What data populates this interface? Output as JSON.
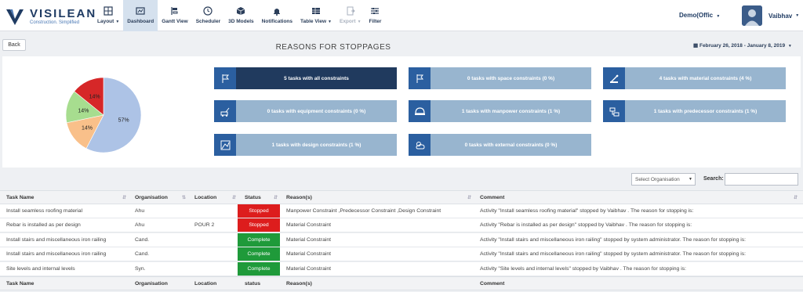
{
  "brand": {
    "name": "VISILEAN",
    "tagline": "Construction. Simplified"
  },
  "nav": [
    {
      "label": "Layout",
      "icon": "layout-icon",
      "caret": true,
      "state": "normal"
    },
    {
      "label": "Dashboard",
      "icon": "dashboard-icon",
      "caret": false,
      "state": "active"
    },
    {
      "label": "Gantt View",
      "icon": "gantt-icon",
      "caret": false,
      "state": "normal"
    },
    {
      "label": "Scheduler",
      "icon": "clock-icon",
      "caret": false,
      "state": "normal"
    },
    {
      "label": "3D Models",
      "icon": "cube-icon",
      "caret": false,
      "state": "normal"
    },
    {
      "label": "Notifications",
      "icon": "bell-icon",
      "caret": false,
      "state": "normal"
    },
    {
      "label": "Table View",
      "icon": "table-icon",
      "caret": true,
      "state": "normal"
    },
    {
      "label": "Export",
      "icon": "export-icon",
      "caret": true,
      "state": "disabled"
    },
    {
      "label": "Filter",
      "icon": "filter-icon",
      "caret": false,
      "state": "normal"
    }
  ],
  "org_menu": {
    "label": "Demo(Offic"
  },
  "user": {
    "name": "Vaibhav"
  },
  "header": {
    "back_label": "Back",
    "title": "REASONS FOR STOPPAGES",
    "date_range": "February 26, 2018 - January 8, 2019"
  },
  "chart_data": {
    "type": "pie",
    "slices": [
      {
        "value": 57,
        "label": "57%",
        "color": "#adc3e6"
      },
      {
        "value": 14,
        "label": "14%",
        "color": "#f9c08a"
      },
      {
        "value": 14,
        "label": "14%",
        "color": "#a7dd8f"
      },
      {
        "value": 14,
        "label": "14%",
        "color": "#d62728"
      }
    ]
  },
  "stat_cards": [
    {
      "text": "5 tasks with all constraints",
      "icon": "flag-icon",
      "dark": true
    },
    {
      "text": "0 tasks with space constraints (0 %)",
      "icon": "flag-icon",
      "dark": false
    },
    {
      "text": "4 tasks with material constraints (4 %)",
      "icon": "material-icon",
      "dark": false
    },
    {
      "text": "0 tasks with equipment constraints (0 %)",
      "icon": "equipment-icon",
      "dark": false
    },
    {
      "text": "1 tasks with manpower constraints (1 %)",
      "icon": "helmet-icon",
      "dark": false
    },
    {
      "text": "1 tasks with predecessor constraints (1 %)",
      "icon": "predecessor-icon",
      "dark": false
    },
    {
      "text": "1 tasks with design constraints (1 %)",
      "icon": "design-icon",
      "dark": false
    },
    {
      "text": "0 tasks with external constraints (0 %)",
      "icon": "weather-icon",
      "dark": false
    }
  ],
  "toolbar": {
    "org_select": "Select Organisation",
    "search_label": "Search:"
  },
  "table": {
    "headers": [
      "Task Name",
      "Organisation",
      "Location",
      "Status",
      "Reason(s)",
      "Comment"
    ],
    "footer": [
      "Task Name",
      "Organisation",
      "Location",
      "status",
      "Reason(s)",
      "Comment"
    ],
    "rows": [
      [
        "Install seamless roofing material",
        "Ahu",
        "",
        "Stopped",
        "Manpower Constraint ,Predecessor Constraint ,Design Constraint",
        "Activity \"Install seamless roofing material\" stopped by Vaibhav . The reason for stopping is:"
      ],
      [
        "Rebar is installed as per design",
        "Ahu",
        "POUR 2",
        "Stopped",
        "Material Constraint",
        "Activity \"Rebar is installed as per design\" stopped by Vaibhav . The reason for stopping is:"
      ],
      [
        "Install stairs and miscellaneous iron railing",
        "Cand.",
        "",
        "Complete",
        "Material Constraint",
        "Activity \"Install stairs and miscellaneous iron railing\" stopped by system administrator. The reason for stopping is:"
      ],
      [
        "Install stairs and miscellaneous iron railing",
        "Cand.",
        "",
        "Complete",
        "Material Constraint",
        "Activity \"Install stairs and miscellaneous iron railing\" stopped by system administrator. The reason for stopping is:"
      ],
      [
        "Site levels and internal levels",
        "Syn.",
        "",
        "Complete",
        "Material Constraint",
        "Activity \"Site levels and internal levels\" stopped by Vaibhav . The reason for stopping is:"
      ]
    ]
  }
}
